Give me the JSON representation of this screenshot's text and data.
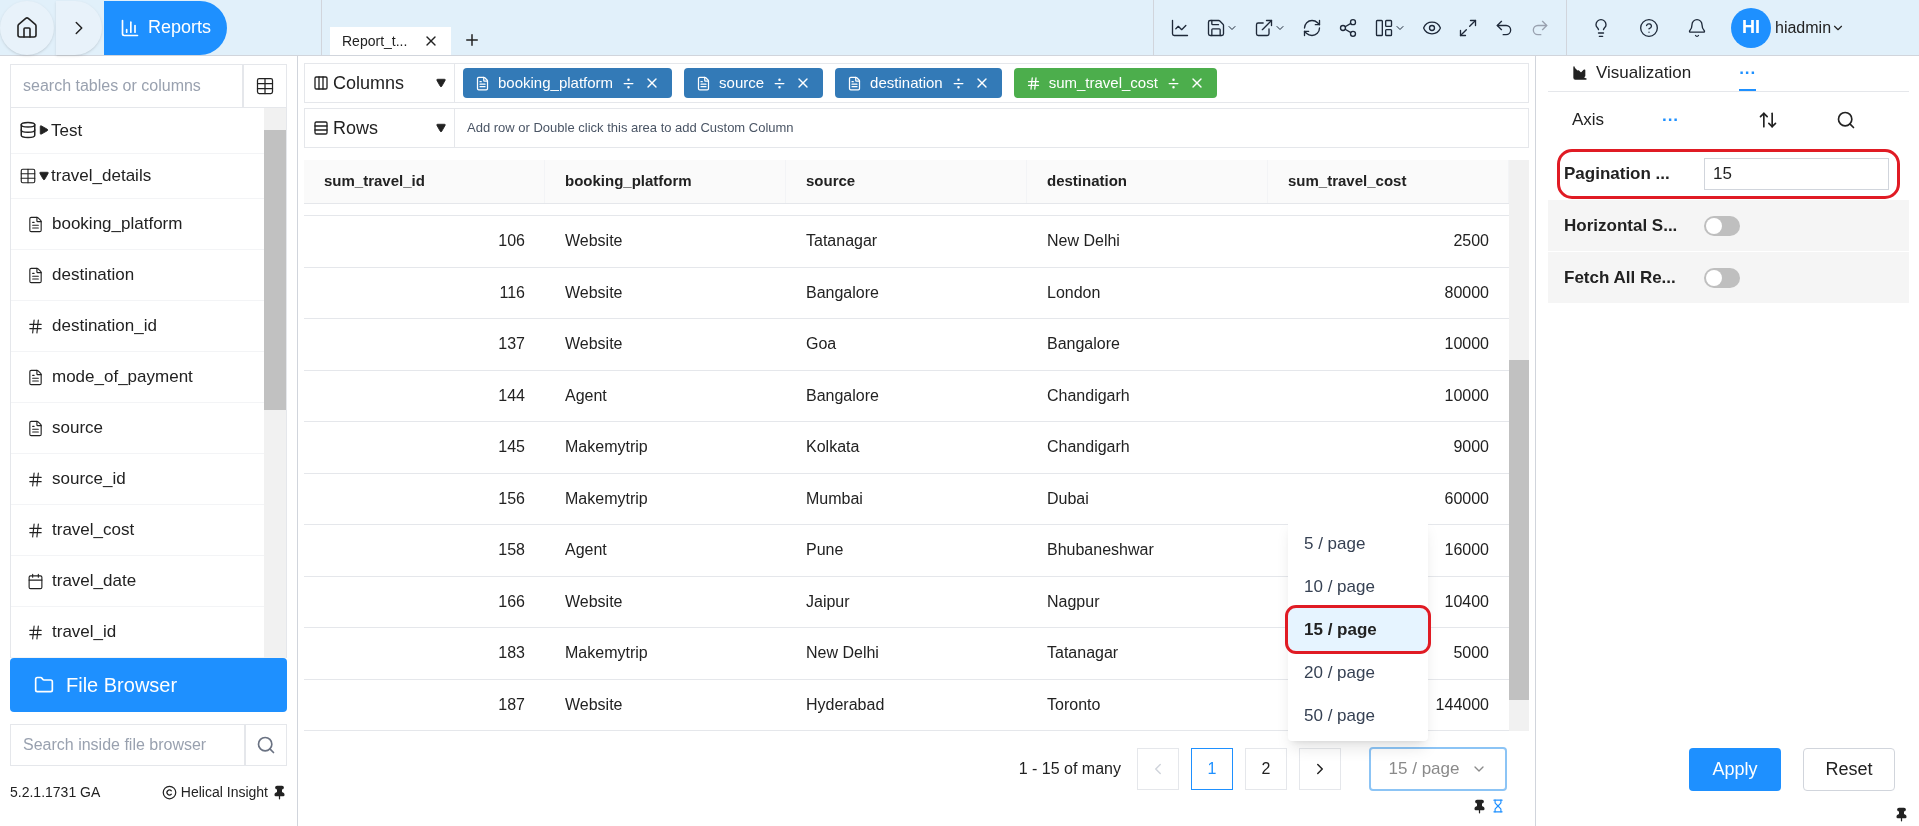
{
  "breadcrumb": {
    "current": "Reports"
  },
  "tabs": [
    {
      "label": "Report_t...",
      "selected": true
    }
  ],
  "toolbar": {
    "redo": {
      "disabled": true
    }
  },
  "user": {
    "initials": "HI",
    "name": "hiadmin"
  },
  "sidebar": {
    "search_placeholder": "search tables or columns",
    "tree": [
      {
        "label": "Test",
        "kind": "datasource",
        "expanded": false
      },
      {
        "label": "travel_details",
        "kind": "table",
        "expanded": true,
        "children": [
          {
            "label": "booking_platform",
            "kind": "text"
          },
          {
            "label": "destination",
            "kind": "text"
          },
          {
            "label": "destination_id",
            "kind": "number"
          },
          {
            "label": "mode_of_payment",
            "kind": "text"
          },
          {
            "label": "source",
            "kind": "text"
          },
          {
            "label": "source_id",
            "kind": "number"
          },
          {
            "label": "travel_cost",
            "kind": "number"
          },
          {
            "label": "travel_date",
            "kind": "date"
          },
          {
            "label": "travel_id",
            "kind": "number"
          }
        ]
      }
    ],
    "file_browser": {
      "label": "File Browser",
      "search_placeholder": "Search inside file browser"
    },
    "version": "5.2.1.1731 GA",
    "brand": "Helical Insight"
  },
  "columns_shelf": {
    "label": "Columns",
    "pills": [
      {
        "label": "booking_platform",
        "kind": "text"
      },
      {
        "label": "source",
        "kind": "text"
      },
      {
        "label": "destination",
        "kind": "text"
      },
      {
        "label": "sum_travel_cost",
        "kind": "number"
      }
    ]
  },
  "rows_shelf": {
    "label": "Rows",
    "placeholder": "Add row or Double click this area to add Custom Column"
  },
  "table": {
    "columns": [
      "sum_travel_id",
      "booking_platform",
      "source",
      "destination",
      "sum_travel_cost"
    ],
    "rows": [
      [
        "106",
        "Website",
        "Tatanagar",
        "New Delhi",
        "2500"
      ],
      [
        "116",
        "Website",
        "Bangalore",
        "London",
        "80000"
      ],
      [
        "137",
        "Website",
        "Goa",
        "Bangalore",
        "10000"
      ],
      [
        "144",
        "Agent",
        "Bangalore",
        "Chandigarh",
        "10000"
      ],
      [
        "145",
        "Makemytrip",
        "Kolkata",
        "Chandigarh",
        "9000"
      ],
      [
        "156",
        "Makemytrip",
        "Mumbai",
        "Dubai",
        "60000"
      ],
      [
        "158",
        "Agent",
        "Pune",
        "Bhubaneshwar",
        "16000"
      ],
      [
        "166",
        "Website",
        "Jaipur",
        "Nagpur",
        "10400"
      ],
      [
        "183",
        "Makemytrip",
        "New Delhi",
        "Tatanagar",
        "5000"
      ],
      [
        "187",
        "Website",
        "Hyderabad",
        "Toronto",
        "144000"
      ]
    ]
  },
  "pagination": {
    "summary": "1 - 15 of many",
    "pages": [
      {
        "label": "1",
        "selected": true
      },
      {
        "label": "2",
        "selected": false
      }
    ],
    "page_size": "15 / page",
    "page_size_options": [
      {
        "label": "5 / page",
        "selected": false
      },
      {
        "label": "10 / page",
        "selected": false
      },
      {
        "label": "15 / page",
        "selected": true
      },
      {
        "label": "20 / page",
        "selected": false
      },
      {
        "label": "50 / page",
        "selected": false
      }
    ]
  },
  "panel": {
    "tabs": [
      {
        "label": "Visualization",
        "kind": "text",
        "selected": false
      },
      {
        "label": "···",
        "kind": "more",
        "selected": true
      }
    ],
    "axis": {
      "label": "Axis",
      "more": "···"
    },
    "settings": [
      {
        "label": "Pagination ...",
        "kind": "input",
        "value": "15",
        "highlighted": true
      },
      {
        "label": "Horizontal S...",
        "kind": "toggle",
        "on": false,
        "highlighted": false
      },
      {
        "label": "Fetch All Re...",
        "kind": "toggle",
        "on": false,
        "highlighted": false
      }
    ],
    "buttons": [
      {
        "label": "Apply",
        "kind": "primary"
      },
      {
        "label": "Reset",
        "kind": "secondary"
      }
    ]
  }
}
